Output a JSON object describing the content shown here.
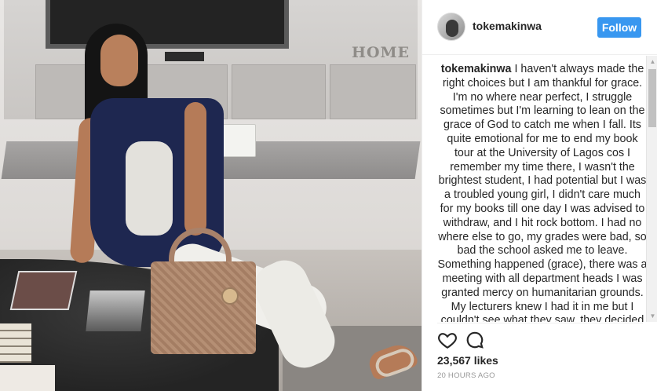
{
  "post": {
    "username": "tokemakinwa",
    "follow_label": "Follow",
    "caption_user": "tokemakinwa",
    "caption_text": " I haven't always made the right choices but I am thankful for grace. I'm no where near perfect, I struggle sometimes but I'm learning to lean on the grace of God to catch me when I fall. Its quite emotional for me to end my book tour at the University of Lagos cos I remember my time there, I wasn't the brightest student, I had potential but I was a troubled young girl, I didn't care much for my books till one day I was advised to withdraw, and I hit rock bottom. I had no where else to go, my grades were bad, so bad the school asked me to leave. Something happened (grace), there was a meeting with all department heads I was granted mercy on humanitarian grounds. My lecturers knew I had it in me but I couldn't see what they saw, they decided to give me an extra year to turn it around. It was",
    "likes": "23,567 likes",
    "timestamp": "20 HOURS AGO"
  },
  "photo": {
    "sign_text": "HOME"
  },
  "icons": {
    "like": "heart-icon",
    "comment": "comment-icon",
    "scroll_up": "arrow-up-icon",
    "scroll_down": "arrow-down-icon"
  },
  "colors": {
    "follow_button": "#3897f0",
    "text": "#262626",
    "muted": "#999999"
  }
}
